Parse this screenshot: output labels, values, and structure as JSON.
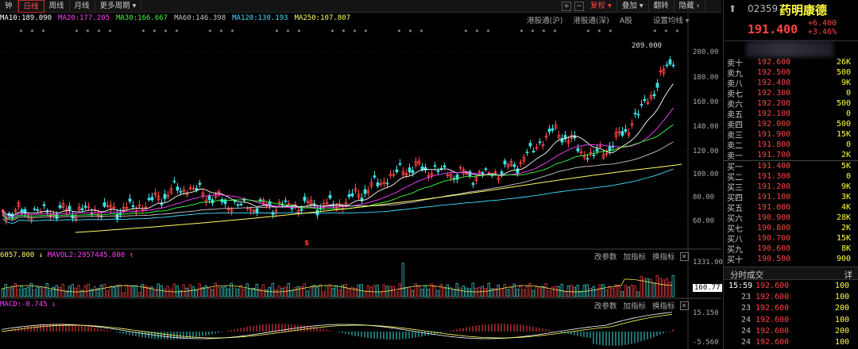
{
  "toolbar": {
    "items": [
      {
        "label": "钟",
        "name": "tab-minute"
      },
      {
        "label": "日线",
        "name": "tab-daily",
        "active": true
      },
      {
        "label": "周线",
        "name": "tab-weekly"
      },
      {
        "label": "月线",
        "name": "tab-monthly"
      },
      {
        "label": "更多周期",
        "name": "tab-more-periods",
        "dropdown": true
      }
    ],
    "right": {
      "fuquan": "复权",
      "overlay": "叠加",
      "flip": "翻转",
      "hide": "隐藏"
    }
  },
  "ma_legend": [
    {
      "label": "MA10:189.090",
      "color": "#ffffff"
    },
    {
      "label": "MA20:177.205",
      "color": "#ff40ff"
    },
    {
      "label": "MA30:166.667",
      "color": "#40ff40"
    },
    {
      "label": "MA60:146.398",
      "color": "#c8c8c8"
    },
    {
      "label": "MA120:130.193",
      "color": "#40e0ff"
    },
    {
      "label": "MA250:107.807",
      "color": "#ffff60"
    }
  ],
  "chart_links": {
    "hgt": "港股通(沪)",
    "sgt": "港股通(深)",
    "ah": "A股",
    "settings": "设置均线"
  },
  "price_axis": [
    "200.00",
    "180.00",
    "160.00",
    "140.00",
    "120.00",
    "100.00",
    "80.00",
    "60.00"
  ],
  "high_label": "209.000",
  "volume_panel": {
    "legend": [
      {
        "label": "6057.800",
        "color": "#ffff60"
      },
      {
        "label": "MAVOL2:2957445.800",
        "color": "#ff40ff"
      }
    ],
    "axis_top": "1331.00",
    "axis_current": "160.77",
    "links": {
      "params": "改参数",
      "add": "加指标",
      "switch": "换指标"
    }
  },
  "macd_panel": {
    "legend": {
      "label": "MACD:-0.745",
      "color": "#ff40ff"
    },
    "axis_top": "15.150",
    "axis_bottom": "-5.560",
    "links": {
      "params": "改参数",
      "add": "加指标",
      "switch": "换指标"
    }
  },
  "quote": {
    "code": "02359",
    "name": "药明康德",
    "price": "191.400",
    "change": "+6.400",
    "change_pct": "+3.46%"
  },
  "asks": [
    {
      "label": "卖十",
      "price": "192.600",
      "vol": "26K"
    },
    {
      "label": "卖九",
      "price": "192.500",
      "vol": "500"
    },
    {
      "label": "卖八",
      "price": "192.400",
      "vol": "9K"
    },
    {
      "label": "卖七",
      "price": "192.300",
      "vol": "0"
    },
    {
      "label": "卖六",
      "price": "192.200",
      "vol": "500"
    },
    {
      "label": "卖五",
      "price": "192.100",
      "vol": "0"
    },
    {
      "label": "卖四",
      "price": "192.000",
      "vol": "500"
    },
    {
      "label": "卖三",
      "price": "191.900",
      "vol": "15K"
    },
    {
      "label": "卖二",
      "price": "191.800",
      "vol": "0"
    },
    {
      "label": "卖一",
      "price": "191.700",
      "vol": "2K"
    }
  ],
  "bids": [
    {
      "label": "买一",
      "price": "191.400",
      "vol": "5K"
    },
    {
      "label": "买二",
      "price": "191.300",
      "vol": "0"
    },
    {
      "label": "买三",
      "price": "191.200",
      "vol": "9K"
    },
    {
      "label": "买四",
      "price": "191.100",
      "vol": "3K"
    },
    {
      "label": "买五",
      "price": "191.000",
      "vol": "4K"
    },
    {
      "label": "买六",
      "price": "190.900",
      "vol": "28K"
    },
    {
      "label": "买七",
      "price": "190.800",
      "vol": "2K"
    },
    {
      "label": "买八",
      "price": "190.700",
      "vol": "15K"
    },
    {
      "label": "买九",
      "price": "190.600",
      "vol": "8K"
    },
    {
      "label": "买十",
      "price": "190.500",
      "vol": "900"
    }
  ],
  "trades_panel": {
    "title": "分时成交",
    "detail": "详",
    "rows": [
      {
        "time": "15:59",
        "price": "192.600",
        "vol": "100"
      },
      {
        "time": "23",
        "price": "192.600",
        "vol": "100"
      },
      {
        "time": "23",
        "price": "192.600",
        "vol": "200"
      },
      {
        "time": "24",
        "price": "192.600",
        "vol": "100"
      },
      {
        "time": "24",
        "price": "192.600",
        "vol": "200"
      },
      {
        "time": "24",
        "price": "192.600",
        "vol": "100"
      }
    ]
  },
  "colors": {
    "up": "#ff4444",
    "down": "#40e0e0",
    "accent": "#ffff40"
  }
}
